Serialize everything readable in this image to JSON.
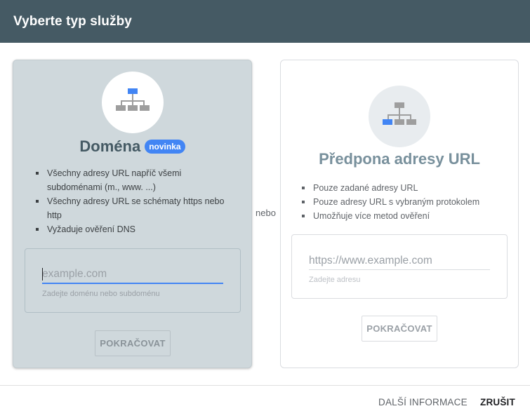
{
  "dialog": {
    "title": "Vyberte typ služby"
  },
  "domain_card": {
    "title": "Doména",
    "badge": "novinka",
    "icon": "sitemap-icon",
    "features": [
      "Všechny adresy URL napříč všemi subdoménami (m., www. ...)",
      "Všechny adresy URL se schématy https nebo http",
      "Vyžaduje ověření DNS"
    ],
    "input_value": "",
    "input_placeholder": "example.com",
    "helper_text": "Zadejte doménu nebo subdoménu",
    "continue_label": "POKRAČOVAT"
  },
  "separator": {
    "label": "nebo"
  },
  "prefix_card": {
    "title": "Předpona adresy URL",
    "icon": "sitemap-icon",
    "features": [
      "Pouze zadané adresy URL",
      "Pouze adresy URL s vybraným protokolem",
      "Umožňuje více metod ověření"
    ],
    "input_value": "",
    "input_placeholder": "https://www.example.com",
    "helper_text": "Zadejte adresu",
    "continue_label": "POKRAČOVAT"
  },
  "footer": {
    "more_info_label": "DALŠÍ INFORMACE",
    "cancel_label": "ZRUŠIT"
  },
  "colors": {
    "header_bg": "#455a64",
    "accent_blue": "#4285f4",
    "selected_card_bg": "#cfd8dc"
  }
}
